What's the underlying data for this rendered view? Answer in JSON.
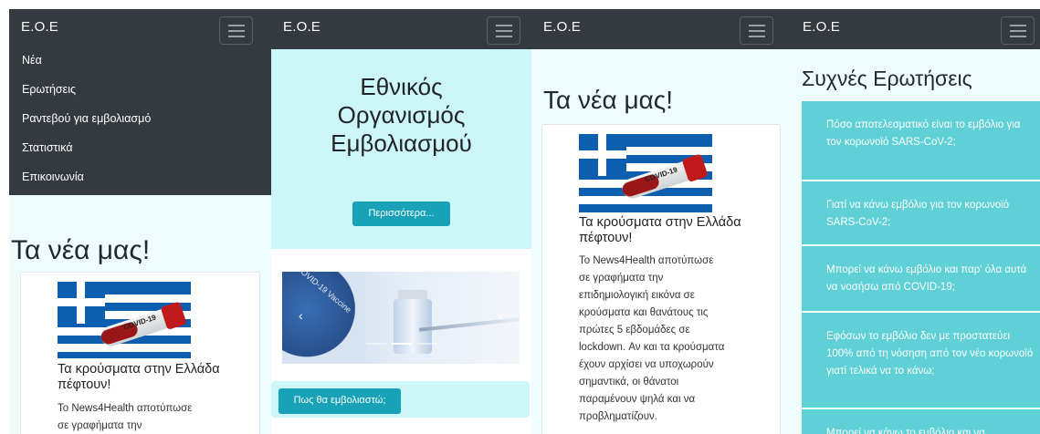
{
  "brand": "E.O.E",
  "menu": {
    "items": [
      "Νέα",
      "Ερωτήσεις",
      "Ραντεβού για εμβολιασμό",
      "Στατιστικά",
      "Επικοινωνία"
    ]
  },
  "news": {
    "heading": "Τα νέα μας!",
    "card_title": "Τα κρούσματα στην Ελλάδα πέφτουν!",
    "card_text_lines": [
      "To News4Health αποτύπωσε",
      "σε γραφήματα την",
      "επιδημιολογική εικόνα σε",
      "κρούσματα και θανάτους τις",
      "πρώτες 5 εβδομάδες σε",
      "lockdown. Αν και τα κρούσματα",
      "έχουν αρχίσει να υποχωρούν",
      "σημαντικά, οι θάνατοι",
      "παραμένουν ψηλά και να",
      "προβληματίζουν."
    ],
    "image_label": "COVID-19"
  },
  "home": {
    "title": "Εθνικός Οργανισμός Εμβολιασμού",
    "more_button": "Περισσότερα...",
    "how_button": "Πως θα εμβολιαστώ;",
    "carousel_prev": "‹",
    "carousel_next": "›",
    "carousel_label": "COVID-19 Vaccine"
  },
  "faq": {
    "heading": "Συχνές Ερωτήσεις",
    "items": [
      "Πόσο αποτελεσματικό είναι το εμβόλιο για τον κορωνοϊό SARS-CoV-2;",
      "Γιατί να κάνω εμβόλιο για τον κορωνοϊό SARS-CoV-2;",
      "Μπορεί να κάνω εμβόλιο και παρ' όλα αυτά να νοσήσω από COVID-19;",
      "Εφόσων το εμβόλιο δεν με προστατεύει 100% από τη νόσηση από τον νέο κορωνοϊό γιατί τελικά να το κάνω;",
      "Μπορεί να κάνω το εμβόλιο και να"
    ]
  },
  "colors": {
    "navbar": "#343a40",
    "accent": "#17a2b8",
    "faq_item": "#5ed0d6",
    "jumbotron": "#cdf6f9"
  }
}
